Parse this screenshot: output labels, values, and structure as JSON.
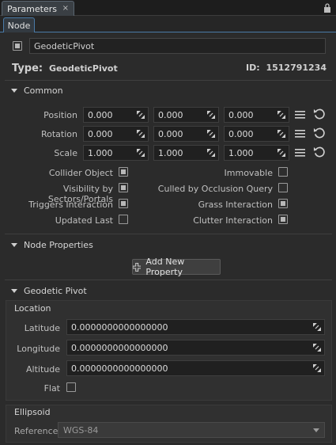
{
  "panel": {
    "tab_label": "Parameters",
    "close_glyph": "×",
    "lock_icon": "lock-icon"
  },
  "subtab": {
    "label": "Node"
  },
  "node": {
    "enabled": true,
    "name": "GeodeticPivot",
    "type_label": "Type:",
    "type_value": "GeodeticPivot",
    "id_label": "ID:",
    "id_value": "1512791234"
  },
  "common": {
    "title": "Common",
    "rows": [
      {
        "label": "Position",
        "values": [
          "0.000",
          "0.000",
          "0.000"
        ]
      },
      {
        "label": "Rotation",
        "values": [
          "0.000",
          "0.000",
          "0.000"
        ]
      },
      {
        "label": "Scale",
        "values": [
          "1.000",
          "1.000",
          "1.000"
        ]
      }
    ],
    "flags_left": [
      {
        "label": "Collider Object",
        "checked": true
      },
      {
        "label": "Visibility by Sectors/Portals",
        "checked": true
      },
      {
        "label": "Triggers Interaction",
        "checked": true
      },
      {
        "label": "Updated Last",
        "checked": false
      }
    ],
    "flags_right": [
      {
        "label": "Immovable",
        "checked": false
      },
      {
        "label": "Culled by Occlusion Query",
        "checked": false
      },
      {
        "label": "Grass Interaction",
        "checked": true
      },
      {
        "label": "Clutter Interaction",
        "checked": true
      }
    ]
  },
  "node_properties": {
    "title": "Node Properties",
    "add_button": "Add New Property"
  },
  "geodetic": {
    "title": "Geodetic Pivot",
    "location_title": "Location",
    "fields": [
      {
        "label": "Latitude",
        "value": "0.0000000000000000"
      },
      {
        "label": "Longitude",
        "value": "0.0000000000000000"
      },
      {
        "label": "Altitude",
        "value": "0.0000000000000000"
      }
    ],
    "flat_label": "Flat",
    "flat_checked": false,
    "ellipsoid_title": "Ellipsoid",
    "reference_label": "Reference",
    "reference_value": "WGS-84"
  }
}
